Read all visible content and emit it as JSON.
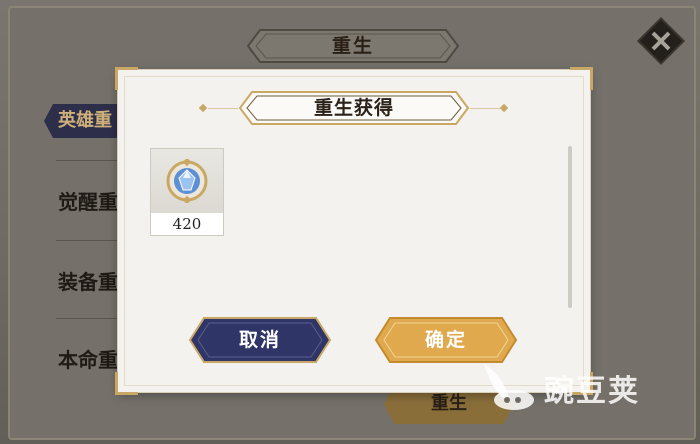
{
  "background": {
    "title": "重生",
    "tabs": [
      {
        "label": "英雄重"
      }
    ],
    "menu": [
      {
        "label": "觉醒重"
      },
      {
        "label": "装备重"
      },
      {
        "label": "本命重"
      }
    ],
    "bottom_button": "重生",
    "close_icon": "close-diamond-icon"
  },
  "dialog": {
    "title": "重生获得",
    "items": [
      {
        "icon": "crystal-gem-icon",
        "count": "420"
      }
    ],
    "buttons": {
      "cancel": "取消",
      "confirm": "确定"
    }
  },
  "watermark": {
    "text": "豌豆荚"
  },
  "colors": {
    "gold": "#c9a866",
    "cancel_bg": "#2f3566",
    "confirm_bg": "#e0a94e",
    "dialog_bg": "#f3f2ef"
  }
}
